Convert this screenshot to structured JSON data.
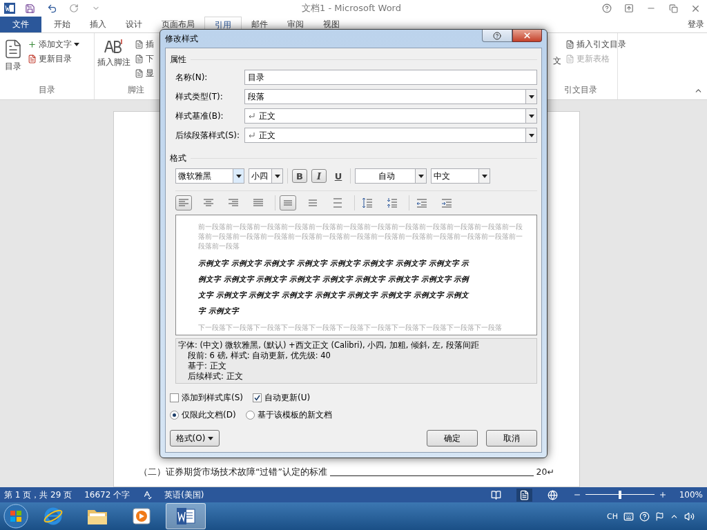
{
  "titlebar": {
    "title": "文档1 - Microsoft Word"
  },
  "ribbon_tabs": [
    {
      "label": "文件",
      "kind": "file",
      "selected": false
    },
    {
      "label": "开始",
      "kind": "tab",
      "selected": false
    },
    {
      "label": "插入",
      "kind": "tab",
      "selected": false
    },
    {
      "label": "设计",
      "kind": "tab",
      "selected": false
    },
    {
      "label": "页面布局",
      "kind": "tab",
      "selected": false
    },
    {
      "label": "引用",
      "kind": "tab",
      "selected": true
    },
    {
      "label": "邮件",
      "kind": "tab",
      "selected": false
    },
    {
      "label": "审阅",
      "kind": "tab",
      "selected": false
    },
    {
      "label": "视图",
      "kind": "tab",
      "selected": false
    }
  ],
  "sign_in": "登录",
  "ribbon": {
    "toc_group": {
      "label": "目录",
      "big_button": "目录",
      "items": [
        {
          "label": "添加文字",
          "dropdown": true
        },
        {
          "label": "更新目录",
          "dropdown": false
        }
      ]
    },
    "footnote_group": {
      "label": "脚注",
      "big_button": "插入脚注",
      "items": [
        "插",
        "下",
        "显"
      ]
    },
    "citation_group": {
      "label": "引文目录",
      "partial_button": "文",
      "items": [
        {
          "label": "插入引文目录",
          "disabled": false
        },
        {
          "label": "更新表格",
          "disabled": true
        }
      ]
    }
  },
  "document": {
    "lines": [
      {
        "text": "（二）证券期货市场技术故障“过错”认定的标准",
        "page": "20↵"
      }
    ]
  },
  "dialog": {
    "title": "修改样式",
    "properties": {
      "label": "属性",
      "fields": [
        {
          "label": "名称(N):",
          "value": "目录",
          "kind": "text"
        },
        {
          "label": "样式类型(T):",
          "value": "段落",
          "kind": "dropdown"
        },
        {
          "label": "样式基准(B):",
          "value": "正文",
          "kind": "paragraph"
        },
        {
          "label": "后续段落样式(S):",
          "value": "正文",
          "kind": "paragraph"
        }
      ]
    },
    "format": {
      "label": "格式",
      "font": "微软雅黑",
      "size": "小四",
      "font_color": "自动",
      "language": "中文",
      "styles": [
        {
          "label": "B",
          "kind": "bold",
          "selected": true
        },
        {
          "label": "I",
          "kind": "italic",
          "selected": true
        },
        {
          "label": "U",
          "kind": "underline",
          "selected": false
        }
      ],
      "paragraph_buttons": [
        {
          "kind": "left",
          "selected": true
        },
        {
          "kind": "center",
          "selected": false
        },
        {
          "kind": "right",
          "selected": false
        },
        {
          "kind": "justify",
          "selected": false
        },
        {
          "kind": "single",
          "selected": true
        },
        {
          "kind": "onehalf",
          "selected": false
        },
        {
          "kind": "double",
          "selected": false
        },
        {
          "kind": "spaceup",
          "selected": false
        },
        {
          "kind": "spacedown",
          "selected": false
        },
        {
          "kind": "outdent",
          "selected": false
        },
        {
          "kind": "indent",
          "selected": false
        }
      ]
    },
    "preview": {
      "previous": "前一段落前一段落前一段落前一段落前一段落前一段落前一段落前一段落前一段落前一段落前一段落前一段落前一段落前一段落前一段落前一段落前一段落前一段落前一段落前一段落前一段落前一段落前一段落前一段落前一段落",
      "sample": [
        "示例文字 示例文字 示例文字 示例文字 示例文字 示例文字 示例文字 示例文字 示",
        "例文字 示例文字 示例文字 示例文字 示例文字 示例文字 示例文字 示例文字 示例",
        "文字 示例文字 示例文字 示例文字 示例文字 示例文字 示例文字 示例文字 示例文",
        "字 示例文字"
      ],
      "next": "下一段落下一段落下一段落下一段落下一段落下一段落下一段落下一段落下一段落下一段落下一段落"
    },
    "description": [
      "字体: (中文) 微软雅黑, (默认) +西文正文 (Calibri), 小四, 加粗, 倾斜, 左, 段落间距",
      "段前: 6 磅, 样式: 自动更新, 优先级: 40",
      "基于: 正文",
      "后续样式: 正文"
    ],
    "checkboxes": [
      {
        "label": "添加到样式库(S)",
        "checked": false
      },
      {
        "label": "自动更新(U)",
        "checked": true
      }
    ],
    "radios": [
      {
        "label": "仅限此文档(D)",
        "selected": true
      },
      {
        "label": "基于该模板的新文档",
        "selected": false
      }
    ],
    "buttons": [
      {
        "label": "格式(O)",
        "kind": "menu"
      },
      {
        "label": "确定",
        "kind": "ok"
      },
      {
        "label": "取消",
        "kind": "cancel"
      }
    ]
  },
  "status_bar": {
    "page": "第 1 页，共 29 页",
    "words": "16672 个字",
    "language": "英语(美国)",
    "views": [
      {
        "kind": "read",
        "selected": false
      },
      {
        "kind": "print",
        "selected": true
      },
      {
        "kind": "web",
        "selected": false
      }
    ],
    "zoom": {
      "level": 0.5,
      "reading": "100%"
    }
  },
  "taskbar": {
    "apps": [
      {
        "kind": "ie",
        "selected": false
      },
      {
        "kind": "explorer",
        "selected": false
      },
      {
        "kind": "media",
        "selected": false
      },
      {
        "kind": "word",
        "selected": true
      }
    ],
    "tray": {
      "input": "CH"
    }
  }
}
